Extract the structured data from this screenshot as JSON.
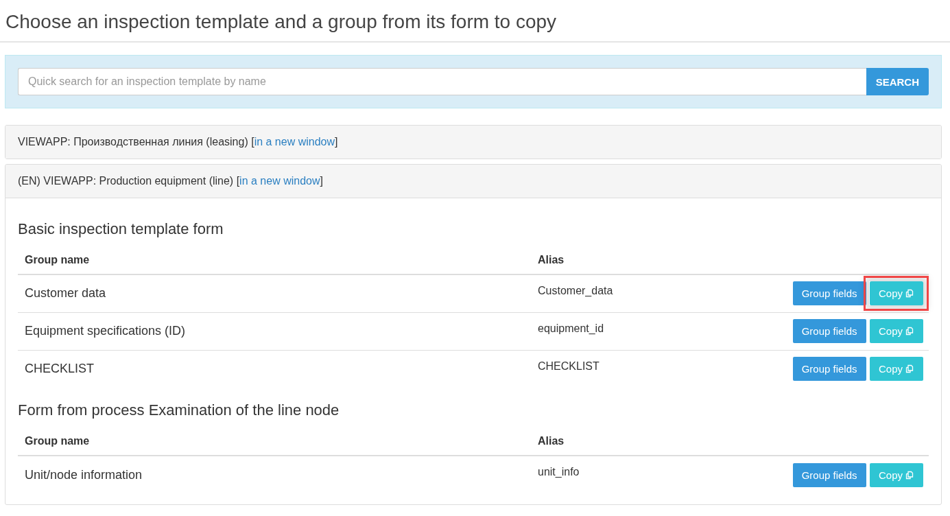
{
  "dialog": {
    "title": "Choose an inspection template and a group from its form to copy"
  },
  "search": {
    "placeholder": "Quick search for an inspection template by name",
    "button": "SEARCH"
  },
  "panels": [
    {
      "title": "VIEWAPP: Производственная линия (leasing)",
      "bracket_open": "[",
      "link": "in a new window",
      "bracket_close": "]",
      "expanded": false
    },
    {
      "title": "(EN) VIEWAPP: Production equipment (line)",
      "bracket_open": "[",
      "link": "in a new window",
      "bracket_close": "]",
      "expanded": true,
      "sections": [
        {
          "heading": "Basic inspection template form",
          "columns": [
            "Group name",
            "Alias"
          ],
          "rows": [
            {
              "group_name": "Customer data",
              "alias": "Customer_data",
              "fields_button": "Group fields",
              "copy_button": "Copy",
              "highlighted": true
            },
            {
              "group_name": "Equipment specifications (ID)",
              "alias": "equipment_id",
              "fields_button": "Group fields",
              "copy_button": "Copy",
              "highlighted": false
            },
            {
              "group_name": "CHECKLIST",
              "alias": "CHECKLIST",
              "fields_button": "Group fields",
              "copy_button": "Copy",
              "highlighted": false
            }
          ]
        },
        {
          "heading": "Form from process Examination of the line node",
          "columns": [
            "Group name",
            "Alias"
          ],
          "rows": [
            {
              "group_name": "Unit/node information",
              "alias": "unit_info",
              "fields_button": "Group fields",
              "copy_button": "Copy",
              "highlighted": false
            }
          ]
        }
      ]
    }
  ]
}
